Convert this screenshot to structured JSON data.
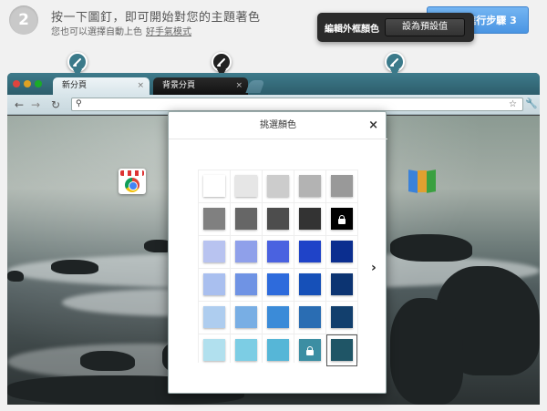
{
  "instruction": {
    "step_number": "2",
    "title": "按一下圖釘，即可開始對您的主題著色",
    "subtitle": "您也可以選擇自動上色",
    "subtitle_link": "好手氣模式"
  },
  "next_step_label": "進行步驟 3",
  "tooltip": {
    "label": "編輯外框顏色",
    "button": "設為預設值"
  },
  "pins": [
    "brush-icon",
    "brush-icon",
    "brush-icon"
  ],
  "browser": {
    "tabs": [
      {
        "label": "新分頁"
      },
      {
        "label": "背景分頁"
      }
    ],
    "close_glyph": "×"
  },
  "dialog": {
    "title": "挑選顏色",
    "close_glyph": "×",
    "next_glyph": "›",
    "swatches": [
      [
        "#ffffff",
        "#e6e6e6",
        "#cccccc",
        "#b3b3b3",
        "#999999"
      ],
      [
        "#808080",
        "#666666",
        "#4d4d4d",
        "#333333",
        "#000000"
      ],
      [
        "#b8c3f0",
        "#8fa0ea",
        "#4a62e0",
        "#1f43c8",
        "#0b2e8f"
      ],
      [
        "#a9bfef",
        "#6f93e4",
        "#2e6bdc",
        "#1650b8",
        "#0c3472"
      ],
      [
        "#aecdef",
        "#78aee4",
        "#3b8bd8",
        "#2a6db3",
        "#123f6d"
      ],
      [
        "#b1e0ee",
        "#7ccde4",
        "#56b6d7",
        "#3c8ea3",
        "#1f5566"
      ]
    ],
    "locked": [
      [
        1,
        4
      ],
      [
        5,
        3
      ]
    ],
    "selected": [
      5,
      4
    ]
  },
  "colors": {
    "accent": "#4a95e3",
    "frame": "#3e7b8b"
  }
}
